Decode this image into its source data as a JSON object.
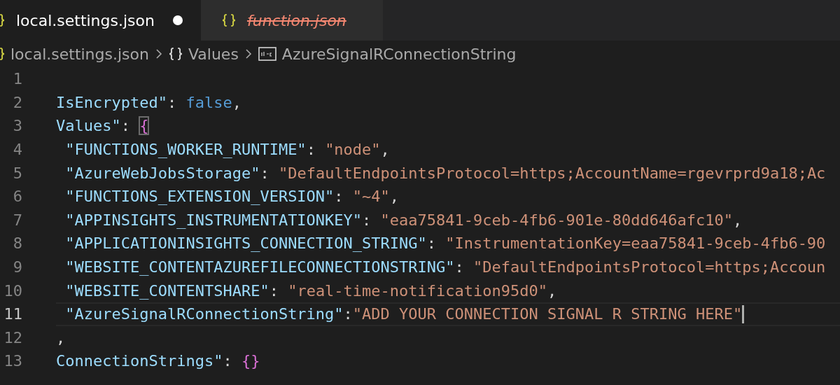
{
  "tabs": [
    {
      "label": "local.settings.json",
      "selected": true,
      "modified": true,
      "deleted": false,
      "icon_cut": true
    },
    {
      "label": "function.json",
      "selected": false,
      "modified": false,
      "deleted": true,
      "icon_cut": false
    }
  ],
  "breadcrumb": [
    {
      "kind": "file",
      "label": "local.settings.json",
      "icon_cut": true
    },
    {
      "kind": "object",
      "label": "Values"
    },
    {
      "kind": "string",
      "label": "AzureSignalRConnectionString"
    }
  ],
  "lines": [
    {
      "number": "1",
      "current": false
    },
    {
      "number": "2",
      "current": false,
      "tokens": [
        {
          "kind": "key",
          "text": "IsEncrypted\""
        },
        {
          "kind": "punct",
          "text": ": "
        },
        {
          "kind": "keyword",
          "text": "false"
        },
        {
          "kind": "punct",
          "text": ","
        }
      ]
    },
    {
      "number": "3",
      "current": false,
      "tokens": [
        {
          "kind": "key",
          "text": "Values\""
        },
        {
          "kind": "punct",
          "text": ": "
        },
        {
          "kind": "brace-match",
          "text": "{"
        }
      ]
    },
    {
      "number": "4",
      "current": false,
      "tokens": [
        {
          "kind": "key",
          "text": " \"FUNCTIONS_WORKER_RUNTIME\""
        },
        {
          "kind": "punct",
          "text": ": "
        },
        {
          "kind": "string",
          "text": "\"node\""
        },
        {
          "kind": "punct",
          "text": ","
        }
      ]
    },
    {
      "number": "5",
      "current": false,
      "tokens": [
        {
          "kind": "key",
          "text": " \"AzureWebJobsStorage\""
        },
        {
          "kind": "punct",
          "text": ": "
        },
        {
          "kind": "string",
          "text": "\"DefaultEndpointsProtocol=https;AccountName=rgevrprd9a18;Ac"
        }
      ]
    },
    {
      "number": "6",
      "current": false,
      "tokens": [
        {
          "kind": "key",
          "text": " \"FUNCTIONS_EXTENSION_VERSION\""
        },
        {
          "kind": "punct",
          "text": ": "
        },
        {
          "kind": "string",
          "text": "\"~4\""
        },
        {
          "kind": "punct",
          "text": ","
        }
      ]
    },
    {
      "number": "7",
      "current": false,
      "tokens": [
        {
          "kind": "key",
          "text": " \"APPINSIGHTS_INSTRUMENTATIONKEY\""
        },
        {
          "kind": "punct",
          "text": ": "
        },
        {
          "kind": "string",
          "text": "\"eaa75841-9ceb-4fb6-901e-80dd646afc10\""
        },
        {
          "kind": "punct",
          "text": ","
        }
      ]
    },
    {
      "number": "8",
      "current": false,
      "tokens": [
        {
          "kind": "key",
          "text": " \"APPLICATIONINSIGHTS_CONNECTION_STRING\""
        },
        {
          "kind": "punct",
          "text": ": "
        },
        {
          "kind": "string",
          "text": "\"InstrumentationKey=eaa75841-9ceb-4fb6-90"
        }
      ]
    },
    {
      "number": "9",
      "current": false,
      "tokens": [
        {
          "kind": "key",
          "text": " \"WEBSITE_CONTENTAZUREFILECONNECTIONSTRING\""
        },
        {
          "kind": "punct",
          "text": ": "
        },
        {
          "kind": "string",
          "text": "\"DefaultEndpointsProtocol=https;Accoun"
        }
      ]
    },
    {
      "number": "10",
      "current": false,
      "tokens": [
        {
          "kind": "key",
          "text": " \"WEBSITE_CONTENTSHARE\""
        },
        {
          "kind": "punct",
          "text": ": "
        },
        {
          "kind": "string",
          "text": "\"real-time-notification95d0\""
        },
        {
          "kind": "punct",
          "text": ","
        }
      ]
    },
    {
      "number": "11",
      "current": true,
      "tokens": [
        {
          "kind": "key",
          "text": " \"AzureSignalRConnectionString\""
        },
        {
          "kind": "punct",
          "text": ":"
        },
        {
          "kind": "string",
          "text": "\"ADD YOUR CONNECTION SIGNAL R STRING HERE\""
        }
      ]
    },
    {
      "number": "12",
      "current": false,
      "tokens": [
        {
          "kind": "punct",
          "text": ","
        }
      ]
    },
    {
      "number": "13",
      "current": false,
      "tokens": [
        {
          "kind": "key",
          "text": "ConnectionStrings\""
        },
        {
          "kind": "punct",
          "text": ": "
        },
        {
          "kind": "brace",
          "text": "{}"
        }
      ]
    }
  ]
}
